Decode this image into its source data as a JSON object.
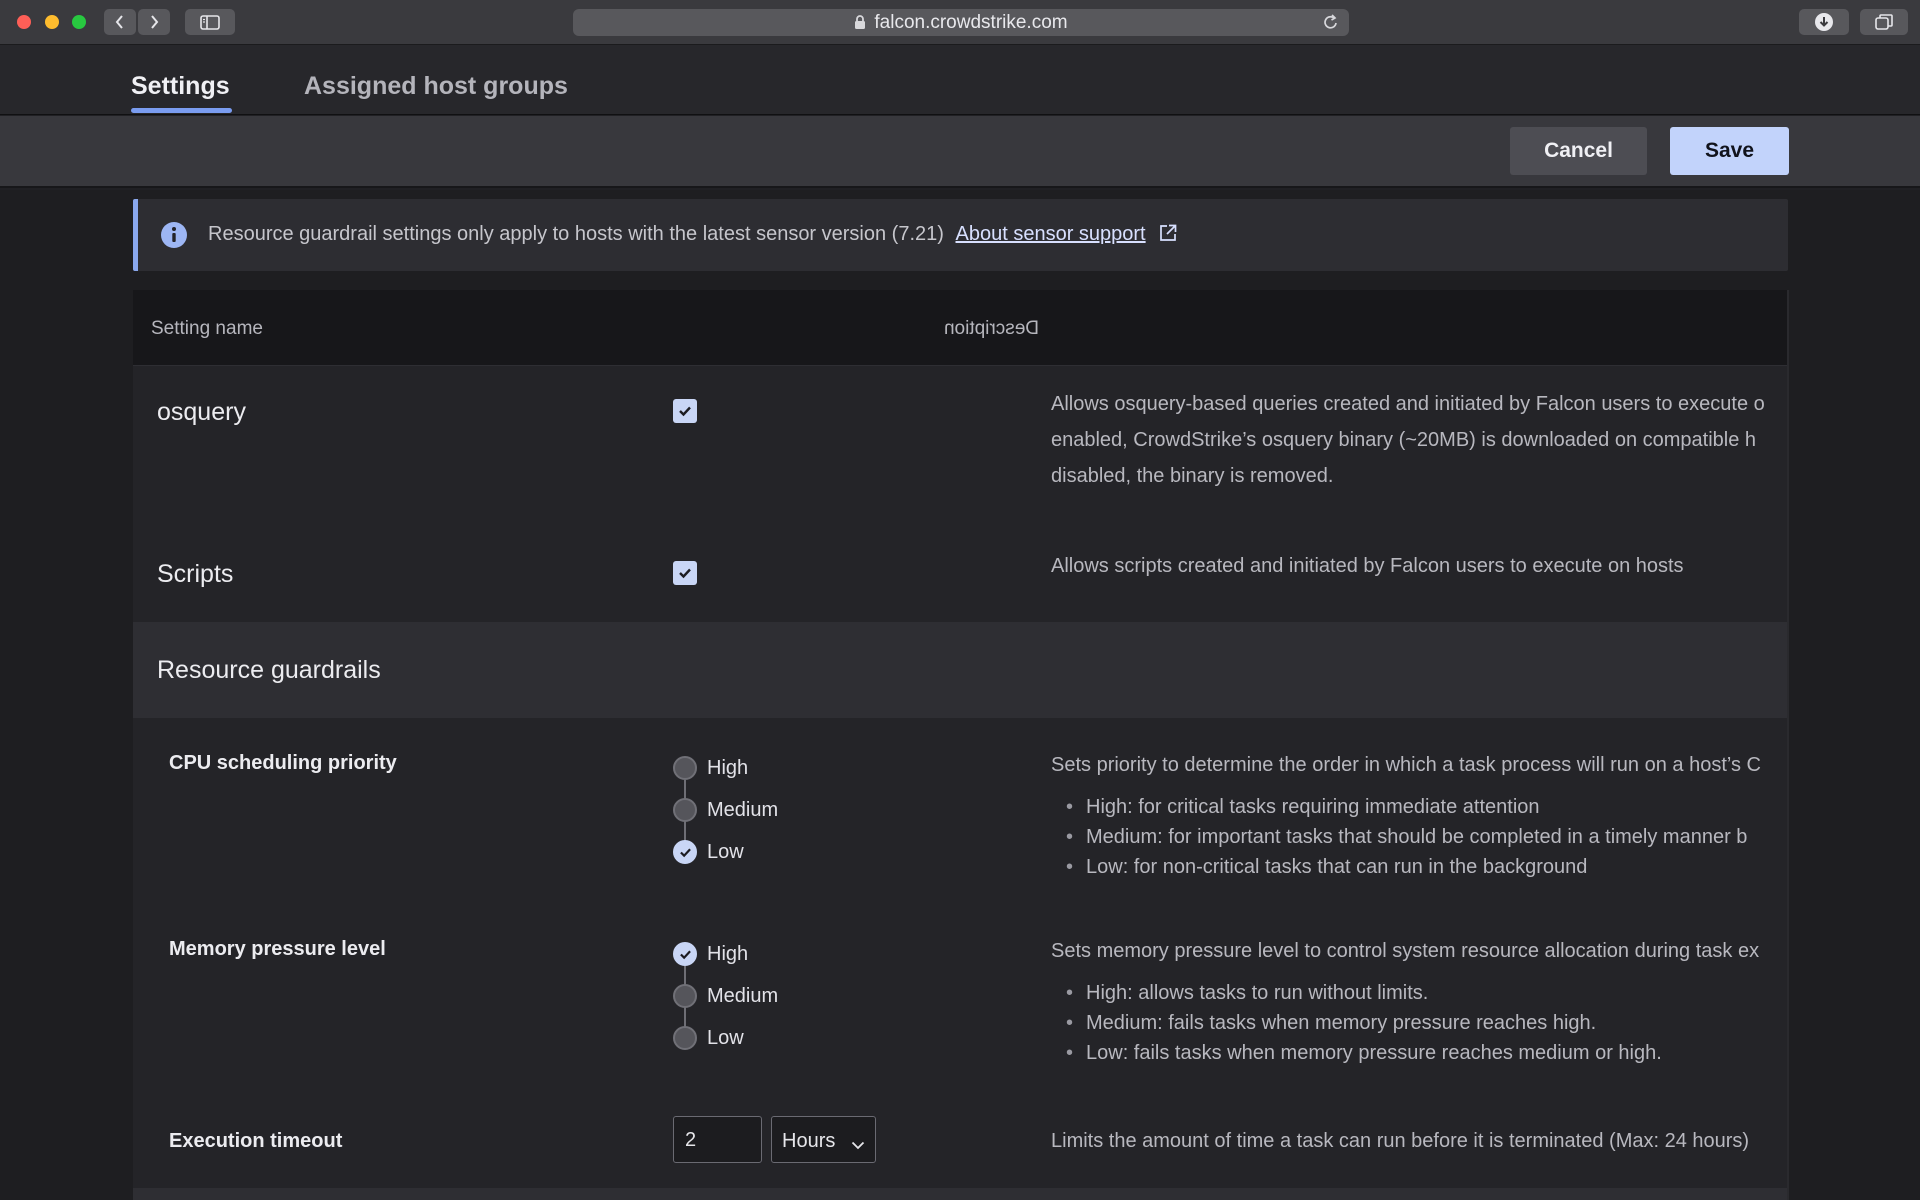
{
  "browser": {
    "url": "falcon.crowdstrike.com"
  },
  "tabs": [
    {
      "label": "Settings",
      "active": true
    },
    {
      "label": "Assigned host groups",
      "active": false
    }
  ],
  "actions": {
    "cancel_label": "Cancel",
    "save_label": "Save"
  },
  "banner": {
    "message": "Resource guardrail settings only apply to hosts with the latest sensor version (7.21)",
    "link_text": "About sensor support"
  },
  "table": {
    "headers": {
      "name": "Setting name",
      "description": "Description"
    },
    "rows": [
      {
        "name": "osquery",
        "enabled": true,
        "description_lines": [
          "Allows osquery-based queries created and initiated by Falcon users to execute o",
          "enabled, CrowdStrike’s osquery binary (~20MB) is downloaded on compatible h",
          "disabled, the binary is removed."
        ]
      },
      {
        "name": "Scripts",
        "enabled": true,
        "description_lines": [
          "Allows scripts created and initiated by Falcon users to execute on hosts"
        ]
      }
    ],
    "section": {
      "title": "Resource guardrails",
      "settings": [
        {
          "name": "CPU scheduling priority",
          "options": [
            "High",
            "Medium",
            "Low"
          ],
          "selected": "Low",
          "description": "Sets priority to determine the order in which a task process will run on a host’s C",
          "bullets": [
            "High: for critical tasks requiring immediate attention",
            "Medium: for important tasks that should be completed in a timely manner b",
            "Low: for non-critical tasks that can run in the background"
          ]
        },
        {
          "name": "Memory pressure level",
          "options": [
            "High",
            "Medium",
            "Low"
          ],
          "selected": "High",
          "description": "Sets memory pressure level to control system resource allocation during task ex",
          "bullets": [
            "High: allows tasks to run without limits.",
            "Medium: fails tasks when memory pressure reaches high.",
            "Low: fails tasks when memory pressure reaches medium or high."
          ]
        },
        {
          "name": "Execution timeout",
          "value": "2",
          "unit": "Hours",
          "description": "Limits the amount of time a task can run before it is terminated (Max: 24 hours)"
        }
      ]
    }
  },
  "icons": {
    "back": "chevron-left-icon",
    "forward": "chevron-right-icon",
    "sidebar": "sidebar-icon",
    "lock": "lock-icon",
    "reload": "reload-icon",
    "download": "download-icon",
    "tabs": "tabs-overview-icon",
    "info": "info-icon",
    "external": "external-link-icon",
    "check": "checkmark-icon",
    "dropdown": "chevron-down-icon"
  },
  "colors": {
    "accent": "#7a9cf0",
    "primary_button": "#c2d3fb",
    "banner_border": "#8aa8ee"
  }
}
